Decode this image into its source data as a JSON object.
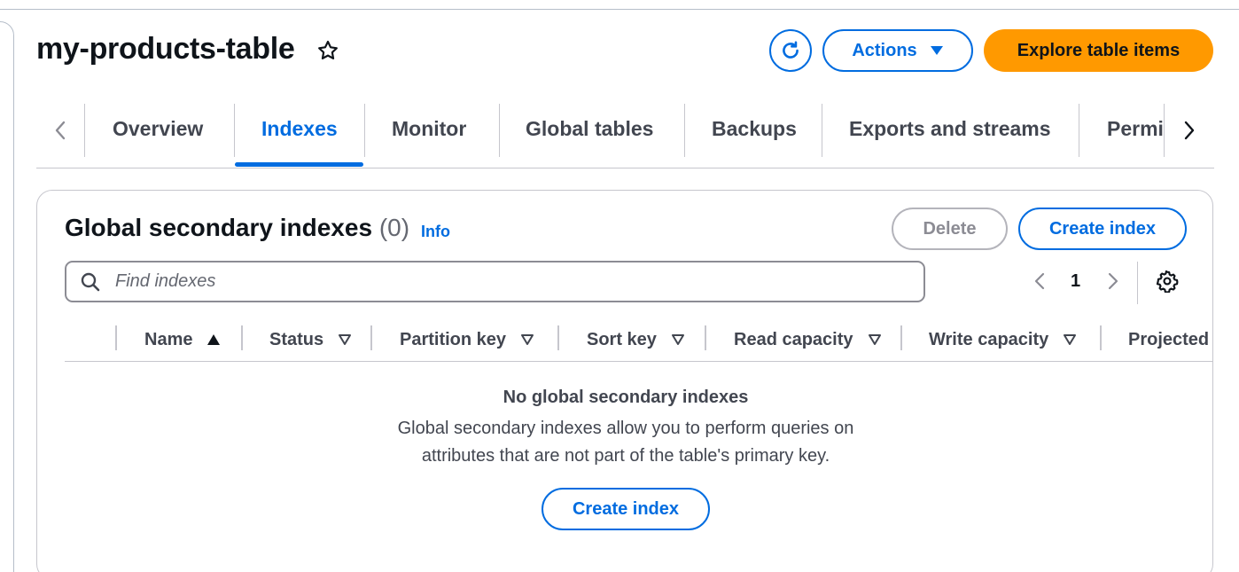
{
  "header": {
    "title": "my-products-table",
    "actions_label": "Actions",
    "explore_label": "Explore table items"
  },
  "tabs": [
    {
      "label": "Overview"
    },
    {
      "label": "Indexes",
      "active": true
    },
    {
      "label": "Monitor"
    },
    {
      "label": "Global tables"
    },
    {
      "label": "Backups"
    },
    {
      "label": "Exports and streams"
    },
    {
      "label": "Permi"
    }
  ],
  "gsi": {
    "title": "Global secondary indexes",
    "count": "(0)",
    "info_label": "Info",
    "delete_label": "Delete",
    "create_label": "Create index",
    "search_placeholder": "Find indexes",
    "page": "1",
    "columns": [
      "Name",
      "Status",
      "Partition key",
      "Sort key",
      "Read capacity",
      "Write capacity",
      "Projected"
    ],
    "empty_title": "No global secondary indexes",
    "empty_desc_line1": "Global secondary indexes allow you to perform queries on",
    "empty_desc_line2": "attributes that are not part of the table's primary key.",
    "empty_create_label": "Create index"
  },
  "colors": {
    "accent": "#006ce0",
    "primary_button": "#ff9900",
    "text": "#0f141a",
    "muted_text": "#424650"
  },
  "icons": [
    "star-icon",
    "refresh-icon",
    "caret-down-icon",
    "chevron-left-icon",
    "chevron-right-icon",
    "search-icon",
    "settings-icon",
    "sort-ascending-icon",
    "sort-caret-icon"
  ]
}
